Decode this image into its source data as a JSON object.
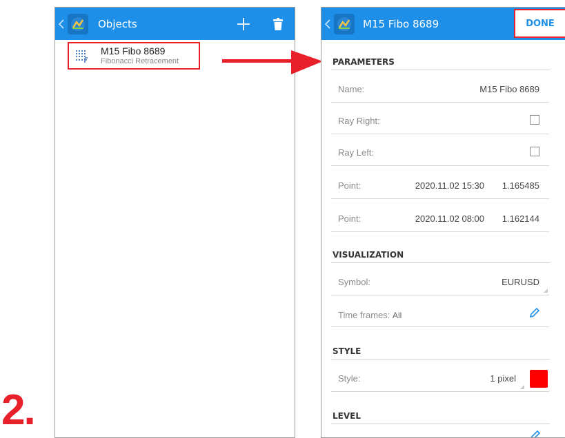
{
  "step_number": "2.",
  "objects_screen": {
    "title": "Objects",
    "object": {
      "name": "M15 Fibo 8689",
      "type": "Fibonacci Retracement"
    }
  },
  "properties_screen": {
    "title": "M15 Fibo 8689",
    "done_label": "DONE",
    "sections": {
      "parameters": "PARAMETERS",
      "visualization": "VISUALIZATION",
      "style": "STYLE",
      "level": "LEVEL"
    },
    "name": {
      "label": "Name:",
      "value": "M15 Fibo 8689"
    },
    "ray_right": {
      "label": "Ray Right:"
    },
    "ray_left": {
      "label": "Ray Left:"
    },
    "point1": {
      "label": "Point:",
      "date": "2020.11.02 15:30",
      "price": "1.165485"
    },
    "point2": {
      "label": "Point:",
      "date": "2020.11.02 08:00",
      "price": "1.162144"
    },
    "symbol": {
      "label": "Symbol:",
      "value": "EURUSD"
    },
    "time_frames": {
      "label": "Time frames:",
      "value": "All"
    },
    "style": {
      "label": "Style:",
      "value": "1 pixel",
      "color": "#ff0000"
    }
  },
  "colors": {
    "appbar": "#1d8fe8",
    "highlight": "#e8202a"
  }
}
